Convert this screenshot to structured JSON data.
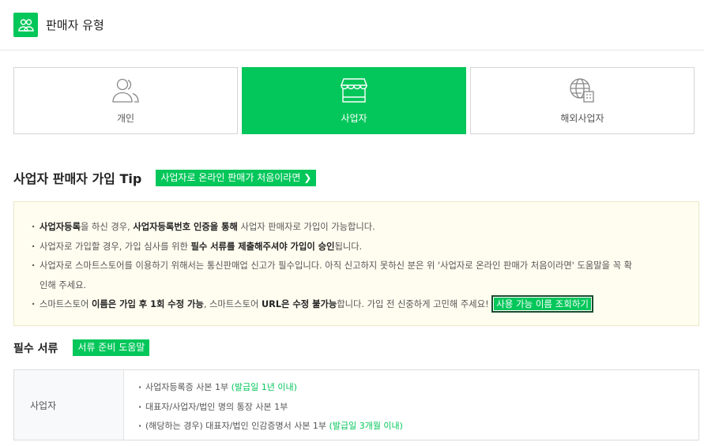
{
  "header": {
    "icon": "seller-group-icon",
    "title": "판매자 유형"
  },
  "seller_types": [
    {
      "label": "개인",
      "icon": "person-icon",
      "selected": false
    },
    {
      "label": "사업자",
      "icon": "store-icon",
      "selected": true
    },
    {
      "label": "해외사업자",
      "icon": "globe-building-icon",
      "selected": false
    }
  ],
  "tip": {
    "title": "사업자 판매자 가입 Tip",
    "button_label": "사업자로 온라인 판매가 처음이라면"
  },
  "notice": {
    "line1": {
      "b1": "사업자등록",
      "t1": "을 하신 경우, ",
      "b2": "사업자등록번호 인증을 통해",
      "t2": " 사업자 판매자로 가입이 가능합니다."
    },
    "line2": {
      "t1": "사업자로 가입할 경우, 가입 심사를 위한 ",
      "b1": "필수 서류를 제출해주셔야 가입이 승인",
      "t2": "됩니다."
    },
    "line3": {
      "t1": "사업자로 스마트스토어를 이용하기 위해서는 통신판매업 신고가 필수입니다. 아직 신고하지 못하신 분은 위 '사업자로 온라인 판매가 처음이라면' 도움말을 꼭 확",
      "t2": "인해 주세요."
    },
    "line4": {
      "t1": "스마트스토어 ",
      "b1": "이름은 가입 후 1회 수정 가능",
      "t2": ", 스마트스토어 ",
      "b2": "URL은 수정 불가능",
      "t3": "합니다. 가입 전 신중하게 고민해 주세요!"
    },
    "check_button": "사용 가능 이름 조회하기"
  },
  "documents": {
    "title": "필수 서류",
    "help_button": "서류 준비 도움말",
    "row_label": "사업자",
    "items": [
      {
        "text": "사업자등록증 사본 1부 ",
        "note": "(발급일 1년 이내)"
      },
      {
        "text": "대표자/사업자/법인 명의 통장 사본 1부",
        "note": ""
      },
      {
        "text": "(해당하는 경우) 대표자/법인 인감증명서 사본 1부 ",
        "note": "(발급일 3개월 이내)"
      }
    ]
  },
  "colors": {
    "accent": "#03c75a",
    "notice_bg": "#fffdf0"
  }
}
